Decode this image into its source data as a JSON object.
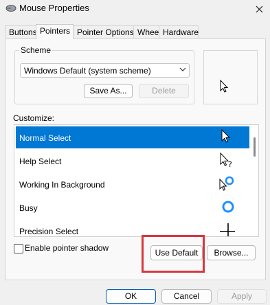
{
  "window": {
    "title": "Mouse Properties",
    "icon": "mouse-icon",
    "close_icon": "close-icon"
  },
  "tabs": [
    {
      "label": "Buttons"
    },
    {
      "label": "Pointers"
    },
    {
      "label": "Pointer Options"
    },
    {
      "label": "Wheel"
    },
    {
      "label": "Hardware"
    }
  ],
  "active_tab": "Pointers",
  "scheme": {
    "label": "Scheme",
    "value": "Windows Default (system scheme)",
    "save_as": "Save As...",
    "delete": "Delete"
  },
  "customize": {
    "label": "Customize:",
    "items": [
      {
        "label": "Normal Select",
        "cursor": "arrow-cursor-icon",
        "selected": true
      },
      {
        "label": "Help Select",
        "cursor": "help-cursor-icon"
      },
      {
        "label": "Working In Background",
        "cursor": "working-cursor-icon"
      },
      {
        "label": "Busy",
        "cursor": "busy-cursor-icon"
      },
      {
        "label": "Precision Select",
        "cursor": "crosshair-cursor-icon"
      }
    ]
  },
  "pointer_shadow": {
    "label": "Enable pointer shadow",
    "checked": false
  },
  "buttons": {
    "use_default": "Use Default",
    "browse": "Browse...",
    "ok": "OK",
    "cancel": "Cancel",
    "apply": "Apply"
  },
  "colors": {
    "accent": "#0078d4",
    "highlight_box": "#d9363e"
  }
}
